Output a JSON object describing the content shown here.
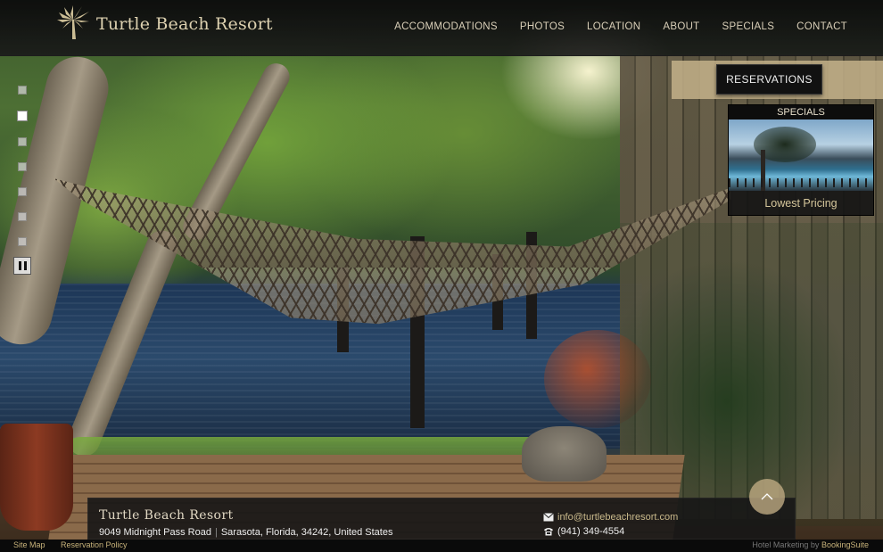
{
  "header": {
    "logo_text": "Turtle Beach Resort",
    "nav": [
      "ACCOMMODATIONS",
      "PHOTOS",
      "LOCATION",
      "ABOUT",
      "SPECIALS",
      "CONTACT"
    ]
  },
  "reservations": {
    "label": "RESERVATIONS"
  },
  "specials": {
    "title": "SPECIALS",
    "caption": "Lowest Pricing"
  },
  "slider": {
    "slide_count": 7,
    "active_index": 1
  },
  "info": {
    "name": "Turtle Beach Resort",
    "street": "9049 Midnight Pass Road",
    "city_state_zip_country": "Sarasota, Florida, 34242, United States",
    "email": "info@turtlebeachresort.com",
    "phone": "(941) 349-4554"
  },
  "footer": {
    "site_map": "Site Map",
    "reservation_policy": "Reservation Policy",
    "credit_prefix": "Hotel Marketing by",
    "credit_brand": "BookingSuite"
  },
  "icons": {
    "logo": "palm-tree-icon",
    "email": "envelope-icon",
    "phone": "telephone-icon",
    "scroll_top": "chevron-up-icon",
    "pause": "pause-icon"
  },
  "colors": {
    "accent": "#c9b98b",
    "header_bg": "#111111",
    "res_bar": "#c4b28a"
  }
}
